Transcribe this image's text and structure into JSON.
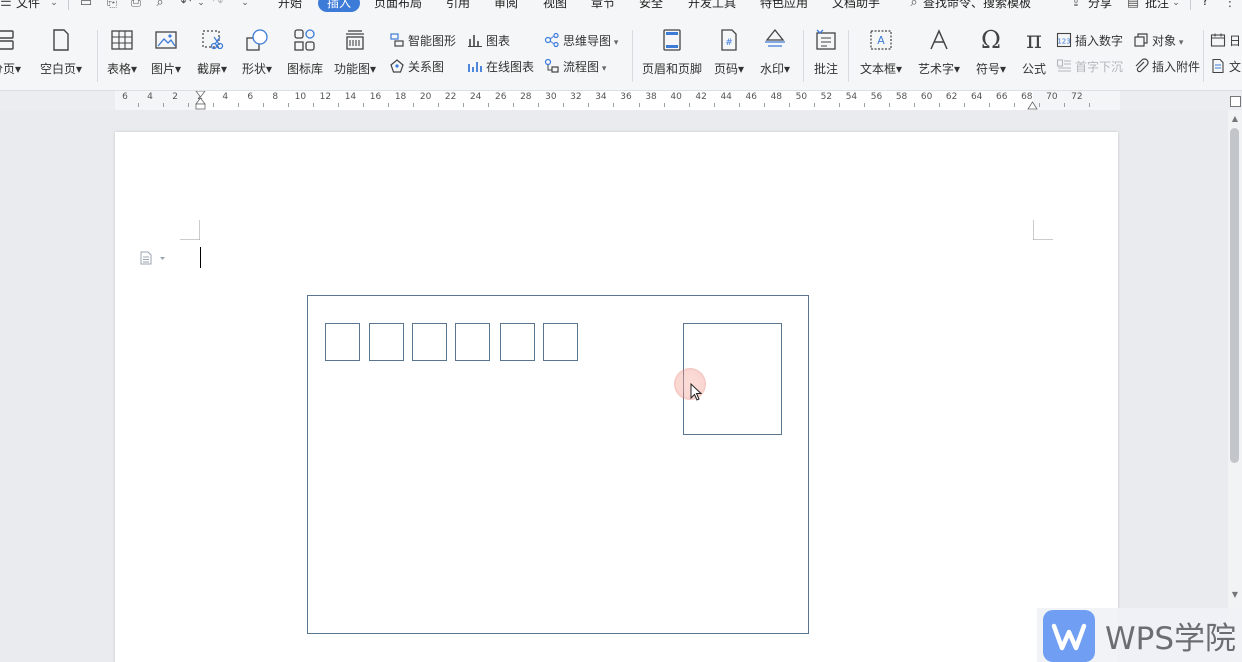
{
  "menubar": {
    "file_label": "文件",
    "tabs": [
      "开始",
      "插入",
      "页面布局",
      "引用",
      "审阅",
      "视图",
      "章节",
      "安全",
      "开发工具",
      "特色应用",
      "文档助手"
    ],
    "active_tab": "插入",
    "search_label": "查找命令、搜索模板",
    "share_label": "分享",
    "comment_label": "批注",
    "help_glyph": "?"
  },
  "ribbon": {
    "page_break": "分页",
    "blank_page": "空白页",
    "table": "表格",
    "picture": "图片",
    "screenshot": "截屏",
    "shape": "形状",
    "icon_library": "图标库",
    "function_chart": "功能图",
    "smart_graphic": "智能图形",
    "chart": "图表",
    "mind_map": "思维导图",
    "relation_chart": "关系图",
    "online_chart": "在线图表",
    "flow_chart": "流程图",
    "header_footer": "页眉和页脚",
    "page_number": "页码",
    "watermark": "水印",
    "comment": "批注",
    "text_box": "文本框",
    "word_art": "艺术字",
    "symbol": "符号",
    "formula": "公式",
    "insert_number": "插入数字",
    "object": "对象",
    "drop_cap": "首字下沉",
    "insert_attachment": "插入附件",
    "date_partial": "日",
    "doc_partial": "文"
  },
  "ruler": {
    "ticks": [
      "6",
      "4",
      "2",
      "2",
      "4",
      "6",
      "8",
      "10",
      "12",
      "14",
      "16",
      "18",
      "20",
      "22",
      "24",
      "26",
      "28",
      "30",
      "32",
      "34",
      "36",
      "38",
      "40",
      "42",
      "44",
      "46",
      "48",
      "50",
      "52",
      "54",
      "56",
      "58",
      "60",
      "62",
      "64",
      "66",
      "68",
      "70",
      "72"
    ]
  },
  "document": {
    "postal_code_box_count": 6
  },
  "watermark_logo": {
    "text": "WPS学院"
  },
  "colors": {
    "accent": "#3d7bd9",
    "envelope_line": "#5a7590",
    "logo_blue": "#6f9ef2"
  }
}
